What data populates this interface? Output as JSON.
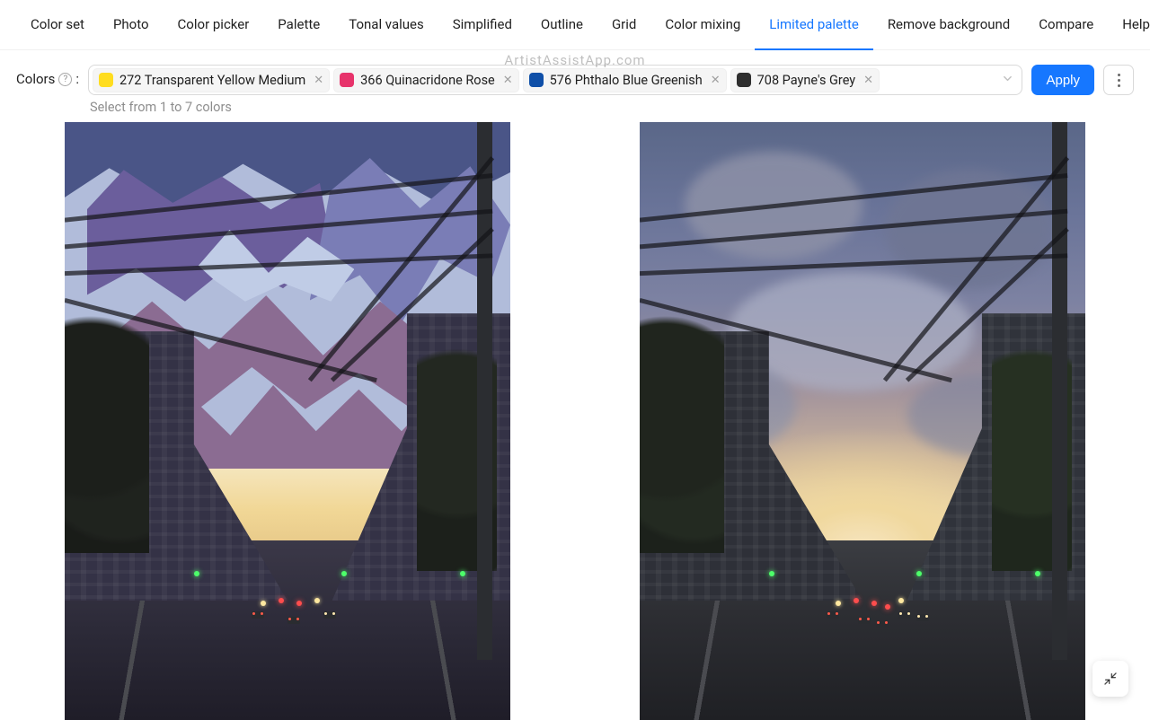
{
  "tabs": [
    "Color set",
    "Photo",
    "Color picker",
    "Palette",
    "Tonal values",
    "Simplified",
    "Outline",
    "Grid",
    "Color mixing",
    "Limited palette",
    "Remove background",
    "Compare",
    "Help"
  ],
  "active_tab_index": 9,
  "watermark": "ArtistAssistApp.com",
  "colors_label": "Colors",
  "colors_label_suffix": ":",
  "helper_text": "Select from 1 to 7 colors",
  "apply_label": "Apply",
  "color_tags": [
    {
      "label": "272 Transparent Yellow Medium",
      "swatch": "#FFDD1F"
    },
    {
      "label": "366 Quinacridone Rose",
      "swatch": "#E7336B"
    },
    {
      "label": "576 Phthalo Blue Greenish",
      "swatch": "#0F4FA8"
    },
    {
      "label": "708 Payne's Grey",
      "swatch": "#2E2E2E"
    }
  ]
}
